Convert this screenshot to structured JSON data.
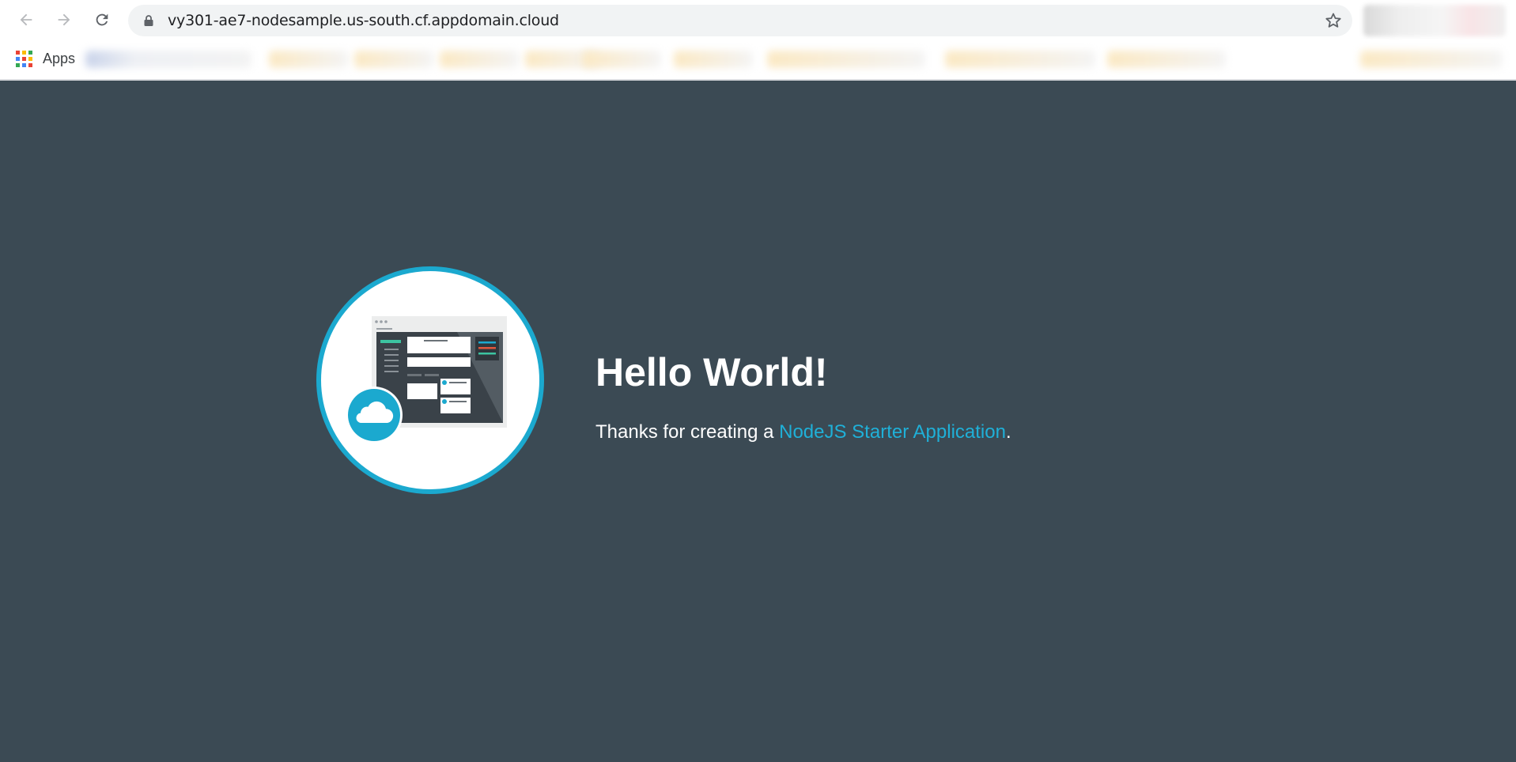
{
  "browser": {
    "url": "vy301-ae7-nodesample.us-south.cf.appdomain.cloud",
    "bookmarks_bar": {
      "apps_label": "Apps"
    }
  },
  "icons": {
    "back": "arrow-left-icon",
    "forward": "arrow-right-icon",
    "reload": "reload-icon",
    "lock": "lock-icon",
    "bookmark_star": "star-icon",
    "apps": "apps-grid-icon",
    "hero": "cloud-app-illustration"
  },
  "page": {
    "heading": "Hello World!",
    "message_prefix": "Thanks for creating a ",
    "link_text": "NodeJS Starter Application",
    "message_suffix": "."
  },
  "colors": {
    "page_background": "#3b4a54",
    "accent": "#1fb0d8",
    "heading": "#ffffff"
  }
}
